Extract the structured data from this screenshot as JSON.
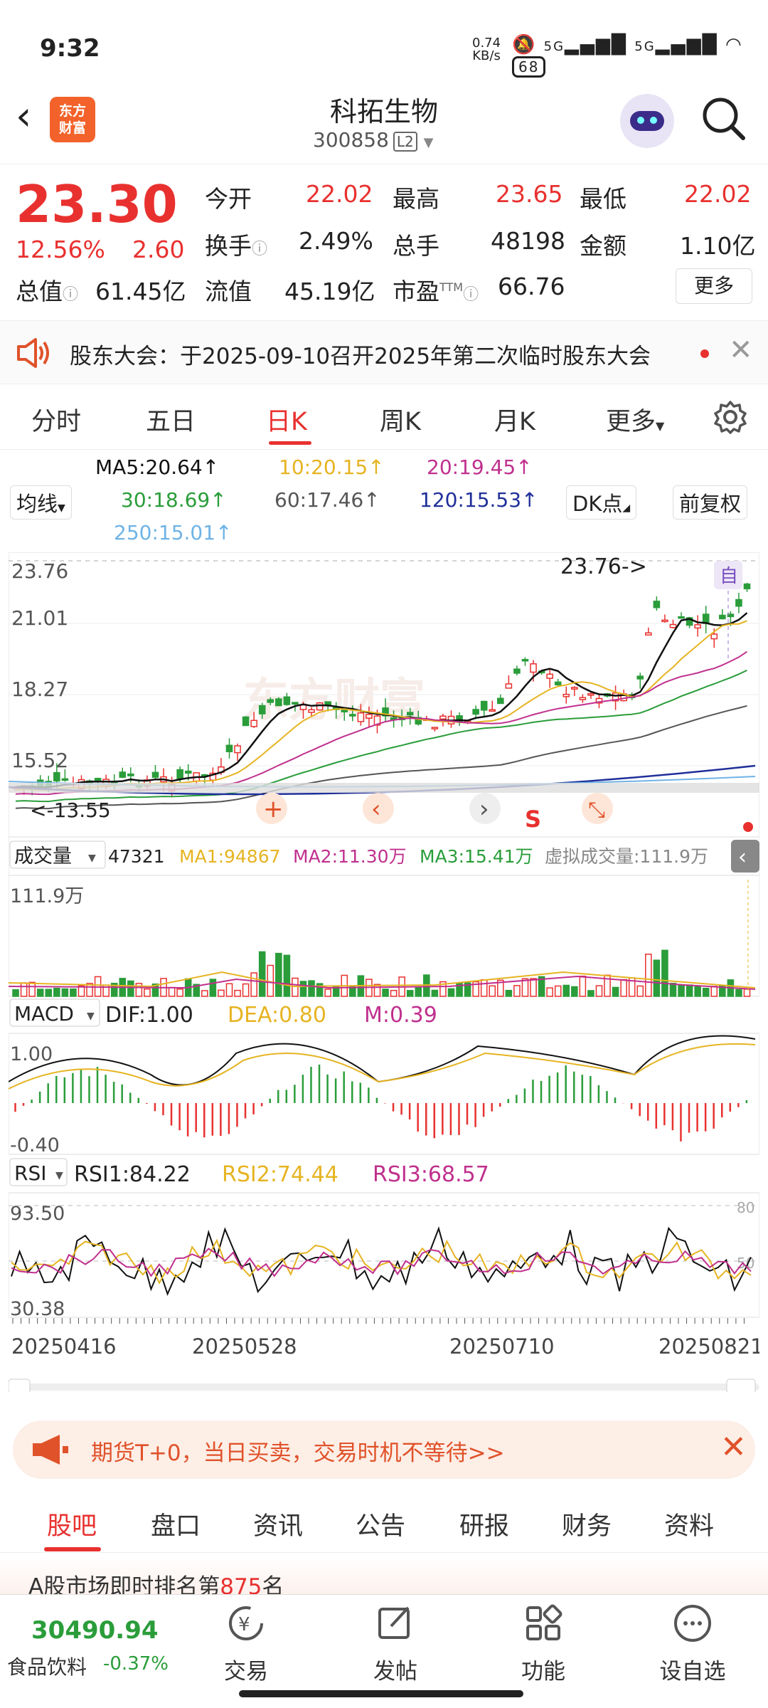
{
  "status_bar": {
    "time": "9:32",
    "speed_value": "0.74",
    "speed_unit": "KB/s",
    "signal1": "5G",
    "signal2": "5G",
    "battery": "68"
  },
  "header": {
    "logo_line1": "东方",
    "logo_line2": "财富",
    "name": "科拓生物",
    "code": "300858",
    "level": "L2"
  },
  "quote": {
    "price": "23.30",
    "change_pct": "12.56%",
    "change_amt": "2.60",
    "open_label": "今开",
    "open": "22.02",
    "high_label": "最高",
    "high": "23.65",
    "low_label": "最低",
    "low": "22.02",
    "turnover_label": "换手",
    "turnover": "2.49%",
    "volume_label": "总手",
    "volume": "48198",
    "amount_label": "金额",
    "amount": "1.10亿",
    "mktcap_label": "总值",
    "mktcap": "61.45亿",
    "float_label": "流值",
    "float": "45.19亿",
    "pe_label": "市盈",
    "pe_sup": "TTM",
    "pe": "66.76",
    "more": "更多"
  },
  "notice": {
    "text": "股东大会：于2025-09-10召开2025年第二次临时股东大会"
  },
  "kline_tabs": [
    "分时",
    "五日",
    "日K",
    "周K",
    "月K",
    "更多"
  ],
  "ma_row": {
    "ma_selector": "均线",
    "ma5": "MA5:20.64",
    "ma10": "10:20.15",
    "ma20": "20:19.45",
    "ma30": "30:18.69",
    "ma60": "60:17.46",
    "ma120": "120:15.53",
    "ma250": "250:15.01",
    "dk": "DK点",
    "adjust": "前复权",
    "arrow": "↑"
  },
  "chart_panel": {
    "price_ticks": [
      "23.76",
      "21.01",
      "18.27",
      "15.52"
    ],
    "high_marker": "23.76->",
    "low_marker": "<-13.55",
    "self_label": "自",
    "s_label": "S",
    "watermark": "东方财富",
    "vol_selector": "成交量",
    "vol_value": "47321",
    "vol_ma1": "MA1:94867",
    "vol_ma2": "MA2:11.30万",
    "vol_ma3": "MA3:15.41万",
    "vol_virtual": "虚拟成交量:111.9万",
    "vol_top": "111.9万",
    "macd_selector": "MACD",
    "dif": "DIF:1.00",
    "dea": "DEA:0.80",
    "m": "M:0.39",
    "macd_top": "1.00",
    "macd_bottom": "-0.40",
    "rsi_selector": "RSI",
    "rsi1": "RSI1:84.22",
    "rsi2": "RSI2:74.44",
    "rsi3": "RSI3:68.57",
    "rsi_top": "93.50",
    "rsi_bottom": "30.38",
    "rsi_80": "80",
    "rsi_50": "50",
    "dates": [
      "20250416",
      "20250528",
      "20250710",
      "20250821"
    ]
  },
  "colors": {
    "up": "#e8312f",
    "down": "#2a9d3a",
    "ma5": "#111111",
    "ma10": "#e6b422",
    "ma20": "#c0308e",
    "ma30": "#2a9d3a",
    "ma60": "#555555",
    "ma120": "#1f2f9a",
    "ma250": "#6fb3e6"
  },
  "promo": {
    "text": "期货T+0，当日买卖，交易时机不等待>>"
  },
  "bottom_tabs": [
    "股吧",
    "盘口",
    "资讯",
    "公告",
    "研报",
    "财务",
    "资料"
  ],
  "peek": {
    "text_prefix": "A股市场即时排名第",
    "rank": "875",
    "text_suffix": "名"
  },
  "bottom_bar": {
    "index_value": "30490.94",
    "index_name": "食品饮料",
    "index_change": "-0.37%",
    "nav": [
      "交易",
      "发帖",
      "功能",
      "设自选"
    ]
  }
}
